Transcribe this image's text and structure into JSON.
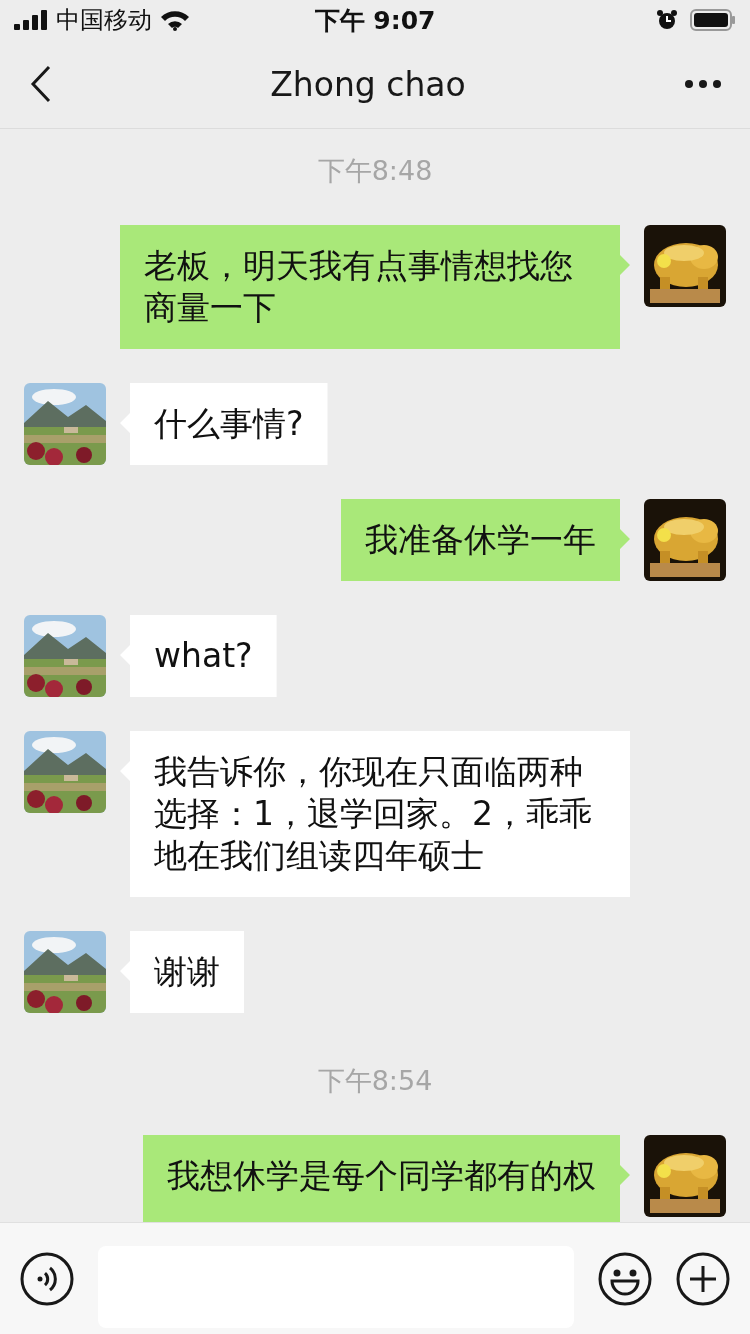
{
  "status_bar": {
    "carrier": "中国移动",
    "time": "下午 9:07"
  },
  "nav_bar": {
    "title": "Zhong chao"
  },
  "messages": [
    {
      "kind": "time",
      "text": "下午8:48"
    },
    {
      "kind": "sent",
      "text": "老板，明天我有点事情想找您商量一下"
    },
    {
      "kind": "received",
      "text": "什么事情?"
    },
    {
      "kind": "sent",
      "text": "我准备休学一年"
    },
    {
      "kind": "received",
      "text": "what?"
    },
    {
      "kind": "received",
      "text": "我告诉你，你现在只面临两种选择：1，退学回家。2，乖乖地在我们组读四年硕士"
    },
    {
      "kind": "received",
      "text": "谢谢"
    },
    {
      "kind": "time",
      "text": "下午8:54"
    },
    {
      "kind": "sent",
      "text": "我想休学是每个同学都有的权"
    }
  ]
}
